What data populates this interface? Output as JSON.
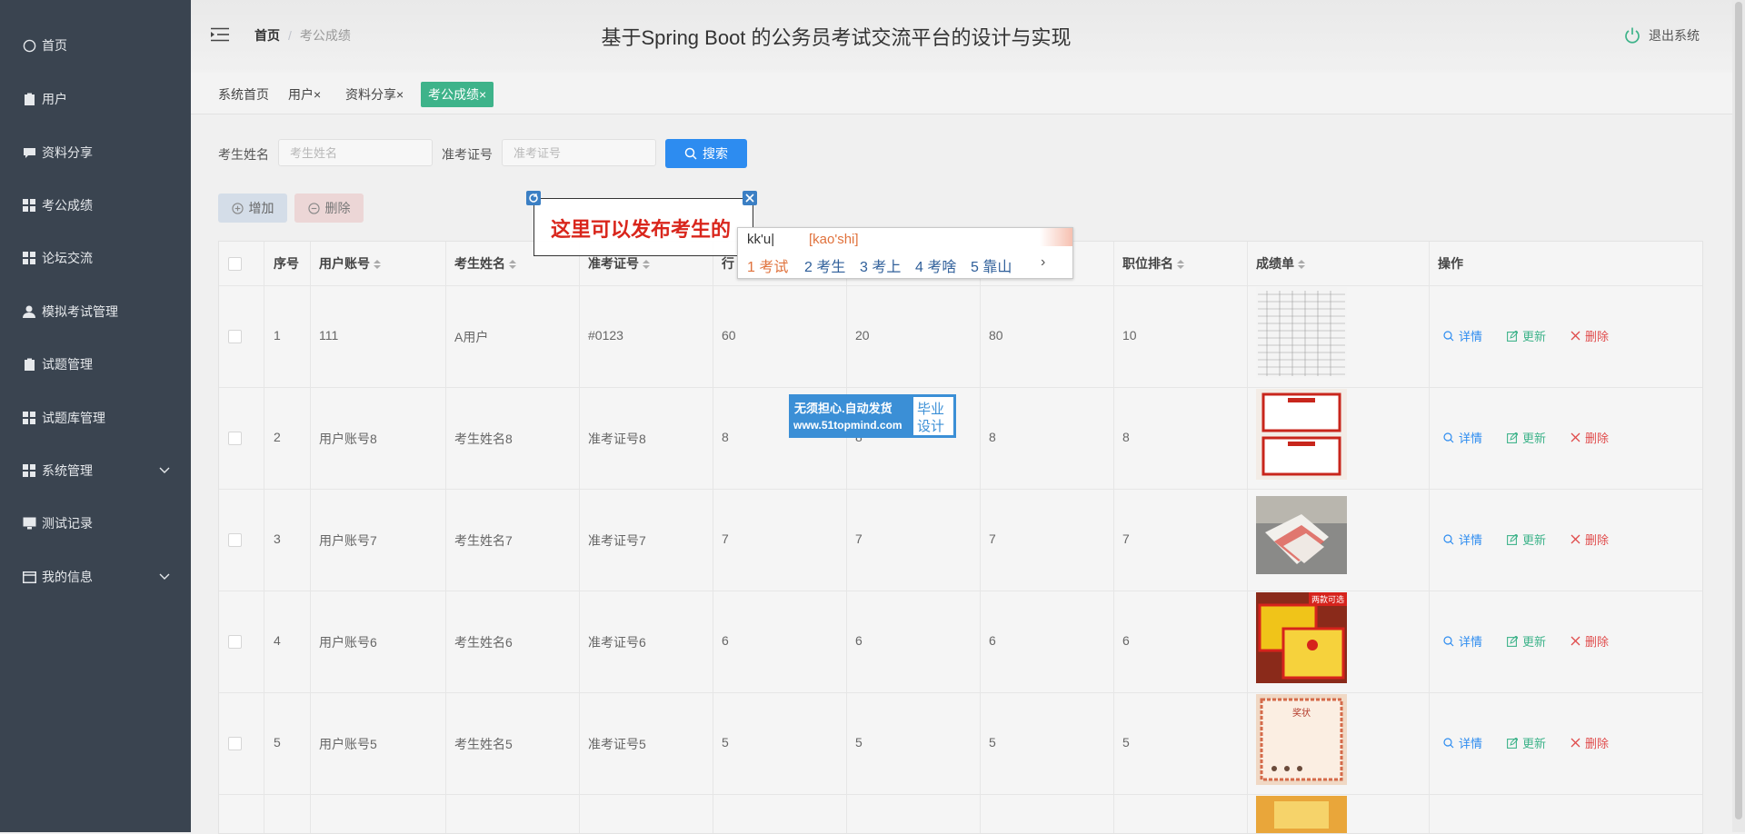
{
  "sidebar": {
    "items": [
      {
        "label": "首页",
        "icon": "home-icon"
      },
      {
        "label": "用户",
        "icon": "clipboard-icon"
      },
      {
        "label": "资料分享",
        "icon": "comment-icon"
      },
      {
        "label": "考公成绩",
        "icon": "grid-icon"
      },
      {
        "label": "论坛交流",
        "icon": "grid-icon"
      },
      {
        "label": "模拟考试管理",
        "icon": "user-icon"
      },
      {
        "label": "试题管理",
        "icon": "clipboard-icon"
      },
      {
        "label": "试题库管理",
        "icon": "grid-icon"
      },
      {
        "label": "系统管理",
        "icon": "grid-icon"
      },
      {
        "label": "测试记录",
        "icon": "monitor-icon"
      },
      {
        "label": "我的信息",
        "icon": "window-icon"
      }
    ]
  },
  "header": {
    "breadcrumb_home": "首页",
    "breadcrumb_sep": "/",
    "breadcrumb_current": "考公成绩",
    "title": "基于Spring Boot 的公务员考试交流平台的设计与实现",
    "logout": "退出系统"
  },
  "tabs": [
    "系统首页",
    "用户",
    "资料分享",
    "考公成绩"
  ],
  "tab_close": "×",
  "search": {
    "name_label": "考生姓名",
    "name_placeholder": "考生姓名",
    "id_label": "准考证号",
    "id_placeholder": "准考证号",
    "button": "搜索"
  },
  "toolbar": {
    "add": "增加",
    "delete": "删除"
  },
  "table": {
    "headers": [
      "序号",
      "用户账号",
      "考生姓名",
      "准考证号",
      "行",
      "",
      "",
      "职位排名",
      "成绩单",
      "操作"
    ],
    "rows": [
      {
        "no": "1",
        "account": "111",
        "name": "A用户",
        "ticket": "#0123",
        "c1": "60",
        "c2": "20",
        "c3": "80",
        "rank": "10"
      },
      {
        "no": "2",
        "account": "用户账号8",
        "name": "考生姓名8",
        "ticket": "准考证号8",
        "c1": "8",
        "c2": "8",
        "c3": "8",
        "rank": "8"
      },
      {
        "no": "3",
        "account": "用户账号7",
        "name": "考生姓名7",
        "ticket": "准考证号7",
        "c1": "7",
        "c2": "7",
        "c3": "7",
        "rank": "7"
      },
      {
        "no": "4",
        "account": "用户账号6",
        "name": "考生姓名6",
        "ticket": "准考证号6",
        "c1": "6",
        "c2": "6",
        "c3": "6",
        "rank": "6"
      },
      {
        "no": "5",
        "account": "用户账号5",
        "name": "考生姓名5",
        "ticket": "准考证号5",
        "c1": "5",
        "c2": "5",
        "c3": "5",
        "rank": "5"
      }
    ],
    "actions": {
      "detail": "详情",
      "update": "更新",
      "delete": "删除"
    },
    "thumb_badge": "两款可选",
    "thumb_title": "奖状"
  },
  "ime": {
    "input": "kk'u",
    "pinyin": "[kao'shi]",
    "candidates": [
      "1 考试",
      "2 考生",
      "3 考上",
      "4 考啥",
      "5 靠山"
    ],
    "next": "›"
  },
  "annotation": {
    "text": "这里可以发布考生的"
  },
  "ad": {
    "line1": "无须担心.自动发货",
    "line2": "www.51topmind.com",
    "right1": "毕业",
    "right2": "设计"
  },
  "colors": {
    "sidebar": "#3a4450",
    "primary": "#2d8cf0",
    "success": "#3eb38a",
    "danger": "#e04b4b"
  }
}
